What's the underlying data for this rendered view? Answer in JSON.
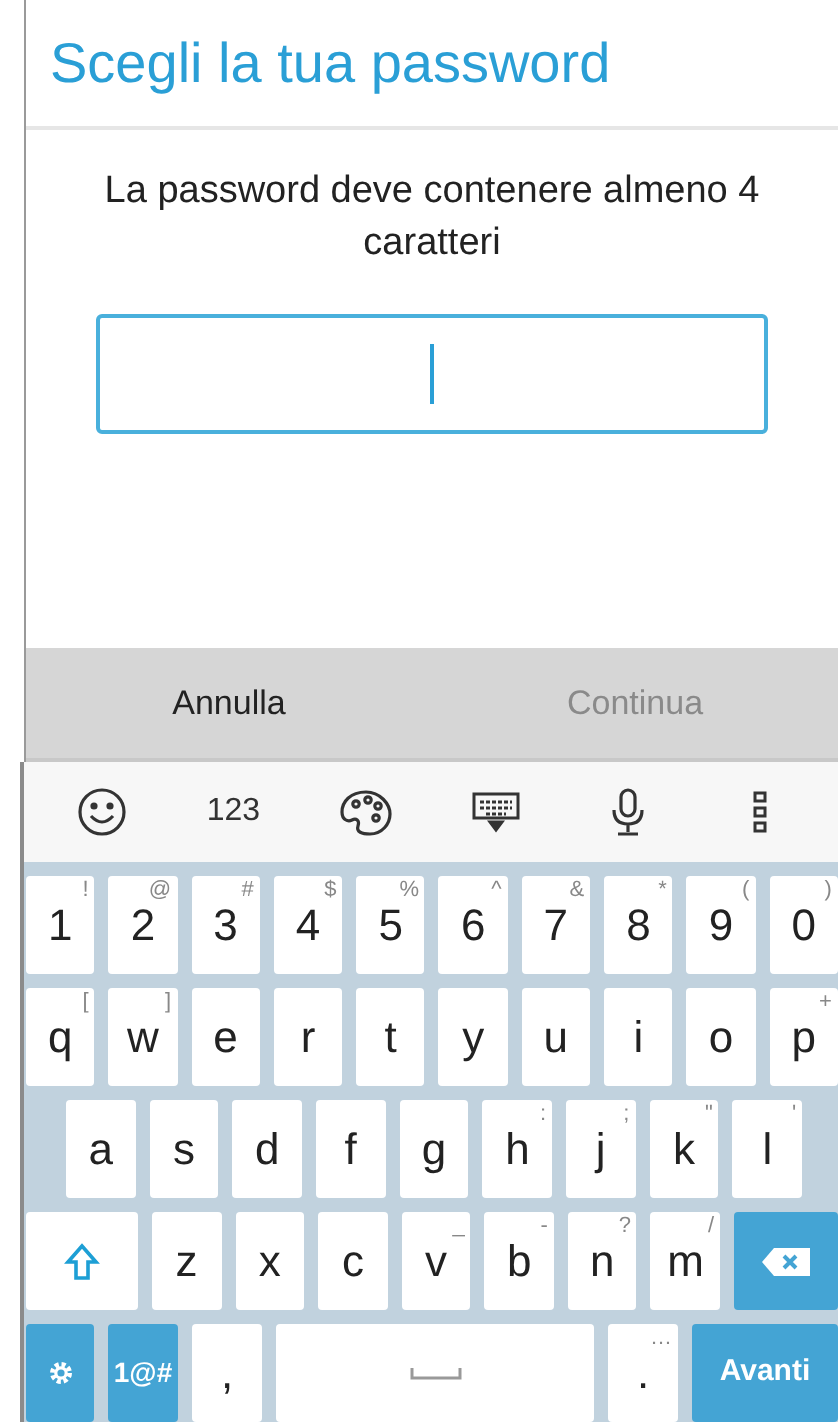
{
  "dialog": {
    "title": "Scegli la tua password",
    "message": "La password deve contenere almeno 4 caratteri",
    "field": {
      "focused": true
    },
    "buttons": [
      {
        "label": "Annulla",
        "disabled": false
      },
      {
        "label": "Continua",
        "disabled": true
      }
    ]
  },
  "keyboard": {
    "toolbar": [
      {
        "kind": "emoji"
      },
      {
        "kind": "text",
        "label": "123"
      },
      {
        "kind": "palette"
      },
      {
        "kind": "hide"
      },
      {
        "kind": "mic"
      },
      {
        "kind": "more"
      }
    ],
    "rows": [
      {
        "keys": [
          {
            "kind": "char",
            "label": "1",
            "hint": "!"
          },
          {
            "kind": "char",
            "label": "2",
            "hint": "@"
          },
          {
            "kind": "char",
            "label": "3",
            "hint": "#"
          },
          {
            "kind": "char",
            "label": "4",
            "hint": "$"
          },
          {
            "kind": "char",
            "label": "5",
            "hint": "%"
          },
          {
            "kind": "char",
            "label": "6",
            "hint": "^"
          },
          {
            "kind": "char",
            "label": "7",
            "hint": "&"
          },
          {
            "kind": "char",
            "label": "8",
            "hint": "*"
          },
          {
            "kind": "char",
            "label": "9",
            "hint": "("
          },
          {
            "kind": "char",
            "label": "0",
            "hint": ")"
          }
        ]
      },
      {
        "keys": [
          {
            "kind": "char",
            "label": "q",
            "hint": "["
          },
          {
            "kind": "char",
            "label": "w",
            "hint": "]"
          },
          {
            "kind": "char",
            "label": "e"
          },
          {
            "kind": "char",
            "label": "r"
          },
          {
            "kind": "char",
            "label": "t"
          },
          {
            "kind": "char",
            "label": "y"
          },
          {
            "kind": "char",
            "label": "u"
          },
          {
            "kind": "char",
            "label": "i"
          },
          {
            "kind": "char",
            "label": "o"
          },
          {
            "kind": "char",
            "label": "p",
            "hint": "+"
          }
        ]
      },
      {
        "keys": [
          {
            "kind": "char",
            "label": "a"
          },
          {
            "kind": "char",
            "label": "s"
          },
          {
            "kind": "char",
            "label": "d"
          },
          {
            "kind": "char",
            "label": "f"
          },
          {
            "kind": "char",
            "label": "g"
          },
          {
            "kind": "char",
            "label": "h",
            "hint": ":"
          },
          {
            "kind": "char",
            "label": "j",
            "hint": ";"
          },
          {
            "kind": "char",
            "label": "k",
            "hint": "\""
          },
          {
            "kind": "char",
            "label": "l",
            "hint": "'"
          }
        ]
      },
      {
        "keys": [
          {
            "kind": "shift"
          },
          {
            "kind": "char",
            "label": "z"
          },
          {
            "kind": "char",
            "label": "x"
          },
          {
            "kind": "char",
            "label": "c"
          },
          {
            "kind": "char",
            "label": "v",
            "hint": "_"
          },
          {
            "kind": "char",
            "label": "b",
            "hint": "-"
          },
          {
            "kind": "char",
            "label": "n",
            "hint": "?"
          },
          {
            "kind": "char",
            "label": "m",
            "hint": "/"
          },
          {
            "kind": "backspace"
          }
        ]
      },
      {
        "keys": [
          {
            "kind": "settings"
          },
          {
            "kind": "symbols",
            "label": "1@#"
          },
          {
            "kind": "char",
            "label": ","
          },
          {
            "kind": "space"
          },
          {
            "kind": "char",
            "label": ".",
            "hint": "…"
          },
          {
            "kind": "action",
            "label": "Avanti"
          }
        ]
      }
    ]
  }
}
